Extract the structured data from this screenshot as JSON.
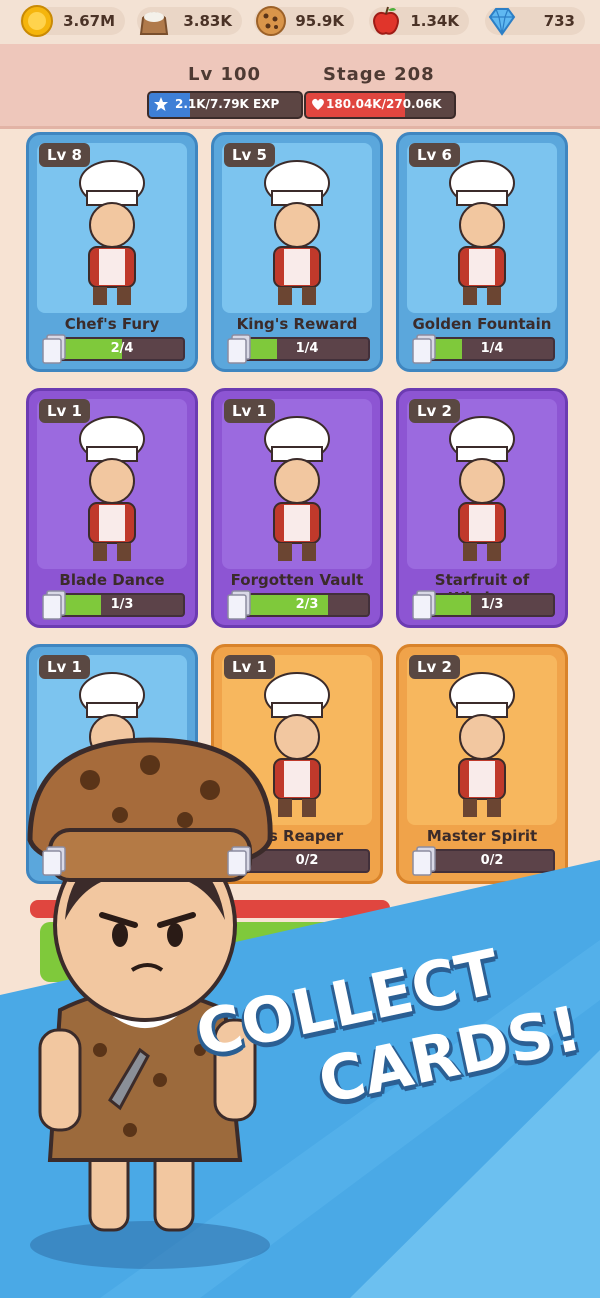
{
  "resources": [
    {
      "icon": "gold-coin-icon",
      "value": "3.67M"
    },
    {
      "icon": "flour-sack-icon",
      "value": "3.83K"
    },
    {
      "icon": "cookie-icon",
      "value": "95.9K"
    },
    {
      "icon": "apple-icon",
      "value": "1.34K"
    },
    {
      "icon": "diamond-icon",
      "value": "733"
    }
  ],
  "player": {
    "level": "Lv 100",
    "stage": "Stage 208",
    "exp": "2.1K/7.79K EXP",
    "exp_fraction": 0.27,
    "hp": "180.04K/270.06K",
    "hp_fraction": 0.67
  },
  "cards": [
    {
      "level": "Lv 8",
      "name": "Chef's Fury",
      "progress": "2/4",
      "fraction": 0.5,
      "color": "blue"
    },
    {
      "level": "Lv 5",
      "name": "King's Reward",
      "progress": "1/4",
      "fraction": 0.25,
      "color": "blue"
    },
    {
      "level": "Lv 6",
      "name": "Golden Fountain",
      "progress": "1/4",
      "fraction": 0.25,
      "color": "blue"
    },
    {
      "level": "Lv 1",
      "name": "Blade Dance",
      "progress": "1/3",
      "fraction": 0.33,
      "color": "purple"
    },
    {
      "level": "Lv 1",
      "name": "Forgotten Vault",
      "progress": "2/3",
      "fraction": 0.67,
      "color": "purple"
    },
    {
      "level": "Lv 2",
      "name": "Starfruit of Wisdom",
      "progress": "1/3",
      "fraction": 0.33,
      "color": "purple"
    },
    {
      "level": "Lv 1",
      "name": "",
      "progress": "",
      "fraction": 0,
      "color": "blue"
    },
    {
      "level": "Lv 1",
      "name": "rus Reaper",
      "progress": "0/2",
      "fraction": 0,
      "color": "orange"
    },
    {
      "level": "Lv 2",
      "name": "Master Spirit",
      "progress": "0/2",
      "fraction": 0,
      "color": "orange"
    }
  ],
  "promo": {
    "line1": "COLLECT",
    "line2": "CARDS!"
  },
  "colors": {
    "banner_blue": "#4aa9e6",
    "exp_blue": "#3e7fd6",
    "hp_red": "#e0463f",
    "progress_green": "#7fc93b"
  }
}
